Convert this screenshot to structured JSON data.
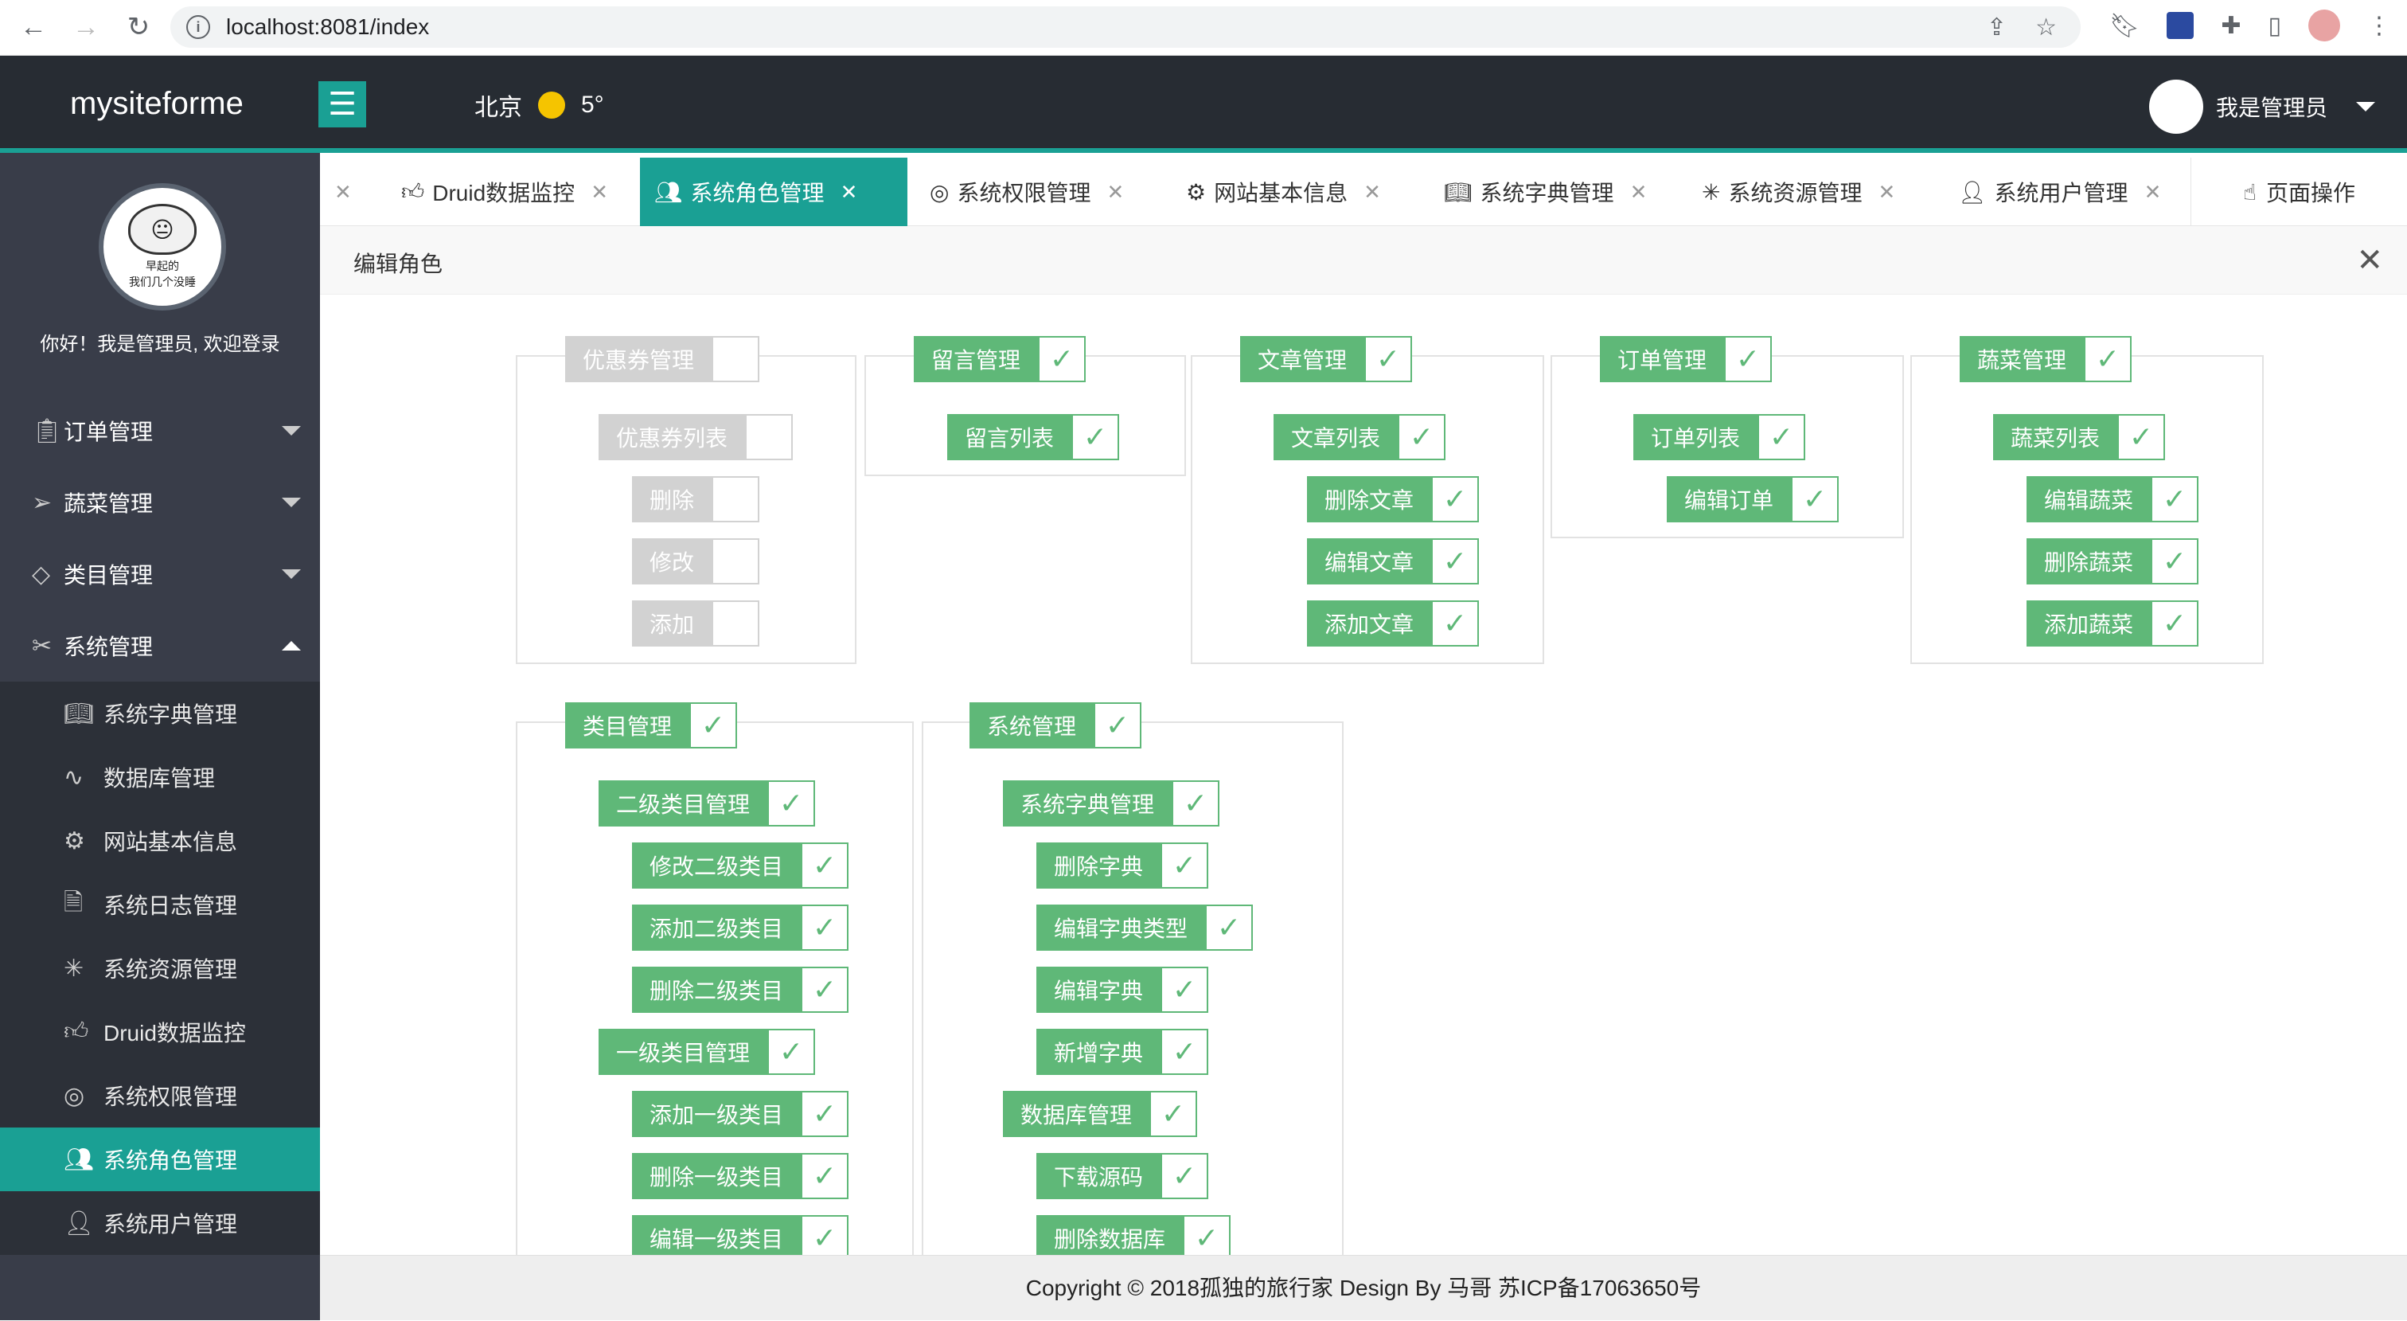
{
  "browser": {
    "url": "localhost:8081/index"
  },
  "header": {
    "logo": "mysiteforme",
    "city": "北京",
    "temperature": "5°",
    "admin_name": "我是管理员"
  },
  "sidebar": {
    "avatar_caption_1": "早起的",
    "avatar_caption_2": "我们几个没睡",
    "welcome": "你好！我是管理员, 欢迎登录",
    "menus": [
      {
        "label": "订单管理",
        "icon": "clipboard-icon"
      },
      {
        "label": "蔬菜管理",
        "icon": "paper-plane-icon"
      },
      {
        "label": "类目管理",
        "icon": "diamond-icon"
      },
      {
        "label": "系统管理",
        "icon": "tools-icon"
      }
    ],
    "sub_items": [
      {
        "label": "系统字典管理",
        "icon": "book-icon"
      },
      {
        "label": "数据库管理",
        "icon": "pulse-icon"
      },
      {
        "label": "网站基本信息",
        "icon": "gear-icon"
      },
      {
        "label": "系统日志管理",
        "icon": "file-icon"
      },
      {
        "label": "系统资源管理",
        "icon": "palm-icon"
      },
      {
        "label": "Druid数据监控",
        "icon": "thumb-up-icon"
      },
      {
        "label": "系统权限管理",
        "icon": "target-icon"
      },
      {
        "label": "系统角色管理",
        "icon": "users-icon"
      },
      {
        "label": "系统用户管理",
        "icon": "user-icon"
      }
    ]
  },
  "tabs": [
    {
      "label": "Druid数据监控",
      "icon": "thumb-up-icon"
    },
    {
      "label": "系统角色管理",
      "icon": "users-icon"
    },
    {
      "label": "系统权限管理",
      "icon": "target-icon"
    },
    {
      "label": "网站基本信息",
      "icon": "gear-icon"
    },
    {
      "label": "系统字典管理",
      "icon": "book-icon"
    },
    {
      "label": "系统资源管理",
      "icon": "palm-icon"
    },
    {
      "label": "系统用户管理",
      "icon": "user-icon"
    }
  ],
  "page_op": "页面操作",
  "panel": {
    "title": "编辑角色"
  },
  "permissions": {
    "coupon": [
      "优惠券管理",
      "优惠券列表",
      "删除",
      "修改",
      "添加"
    ],
    "message": [
      "留言管理",
      "留言列表"
    ],
    "article": [
      "文章管理",
      "文章列表",
      "删除文章",
      "编辑文章",
      "添加文章"
    ],
    "order": [
      "订单管理",
      "订单列表",
      "编辑订单"
    ],
    "veg": [
      "蔬菜管理",
      "蔬菜列表",
      "编辑蔬菜",
      "删除蔬菜",
      "添加蔬菜"
    ],
    "category": [
      "类目管理",
      "二级类目管理",
      "修改二级类目",
      "添加二级类目",
      "删除二级类目",
      "一级类目管理",
      "添加一级类目",
      "删除一级类目",
      "编辑一级类目"
    ],
    "system": [
      "系统管理",
      "系统字典管理",
      "删除字典",
      "编辑字典类型",
      "编辑字典",
      "新增字典",
      "数据库管理",
      "下载源码",
      "删除数据库"
    ]
  },
  "footer": "Copyright © 2018孤独的旅行家 Design By 马哥 苏ICP备17063650号",
  "colors": {
    "accent": "#1aa094",
    "checked": "#5fb878",
    "unchecked": "#d2d2d2",
    "sidebar": "#393d49",
    "header": "#272c33"
  }
}
